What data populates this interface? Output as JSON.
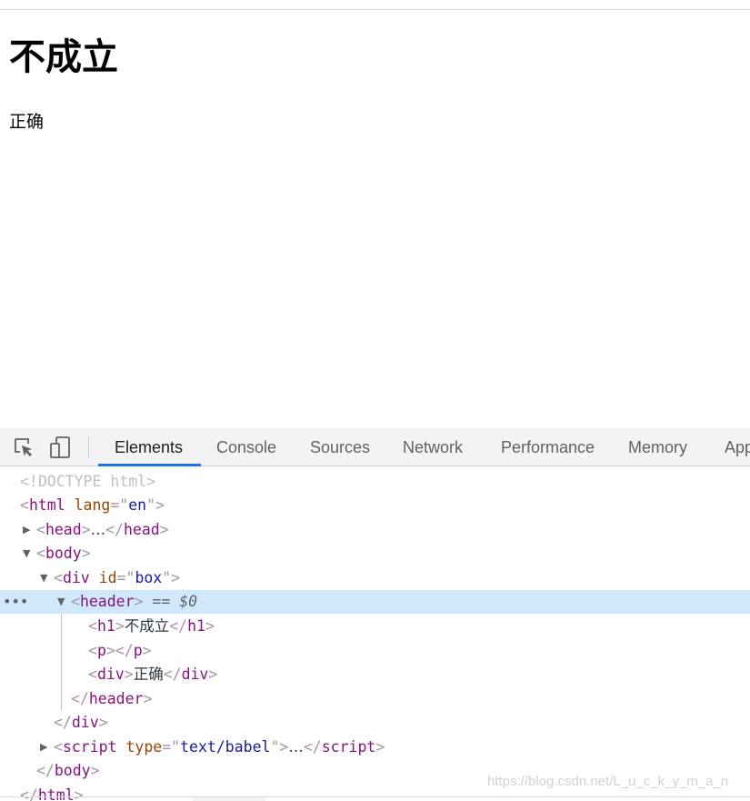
{
  "page": {
    "heading": "不成立",
    "div_text": "正确"
  },
  "devtools": {
    "tabs": [
      {
        "label": "Elements",
        "active": true
      },
      {
        "label": "Console"
      },
      {
        "label": "Sources"
      },
      {
        "label": "Network"
      },
      {
        "label": "Performance"
      },
      {
        "label": "Memory"
      },
      {
        "label": "App"
      }
    ],
    "icons": [
      "inspect-element-icon",
      "device-toolbar-icon"
    ],
    "tree": {
      "doctype": "<!DOCTYPE html>",
      "html_tag": "html",
      "lang_attr": "lang",
      "lang_val": "en",
      "head_tag": "head",
      "collapsed": "…",
      "body_tag": "body",
      "div_tag": "div",
      "id_attr": "id",
      "id_val": "box",
      "header_tag": "header",
      "selected_marker": "== $0",
      "h1_tag": "h1",
      "h1_text": "不成立",
      "p_tag": "p",
      "inner_div_text": "正确",
      "script_tag": "script",
      "type_attr": "type",
      "type_val": "text/babel"
    },
    "row_dots": "•••"
  },
  "watermark": "https://blog.csdn.net/L_u_c_k_y_m_a_n",
  "colors": {
    "accent": "#1a73e8",
    "selected_row": "#cfe8fc",
    "tag": "#881280",
    "attr": "#994500",
    "value": "#1a1aa6"
  }
}
